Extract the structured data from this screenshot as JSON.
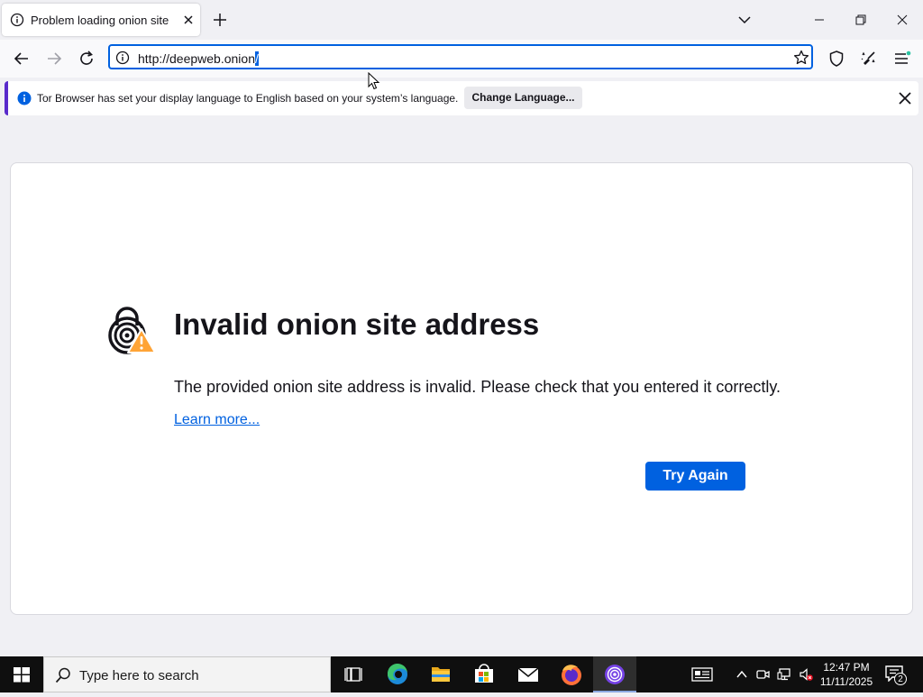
{
  "tab": {
    "title": "Problem loading onion site"
  },
  "urlbar": {
    "url_text": "http://deepweb.onion",
    "url_selected": "/"
  },
  "notification": {
    "message": "Tor Browser has set your display language to English based on your system’s language.",
    "button_label": "Change Language..."
  },
  "error": {
    "title": "Invalid onion site address",
    "description": "The provided onion site address is invalid. Please check that you entered it correctly.",
    "learn_more": "Learn more...",
    "try_again": "Try Again"
  },
  "taskbar": {
    "search_placeholder": "Type here to search",
    "time": "12:47 PM",
    "date": "11/11/2025",
    "notification_count": "2"
  },
  "colors": {
    "accent": "#0061e0",
    "notification_border": "#592acb",
    "warning": "#ffa436",
    "tor_purple": "#7542e5"
  }
}
